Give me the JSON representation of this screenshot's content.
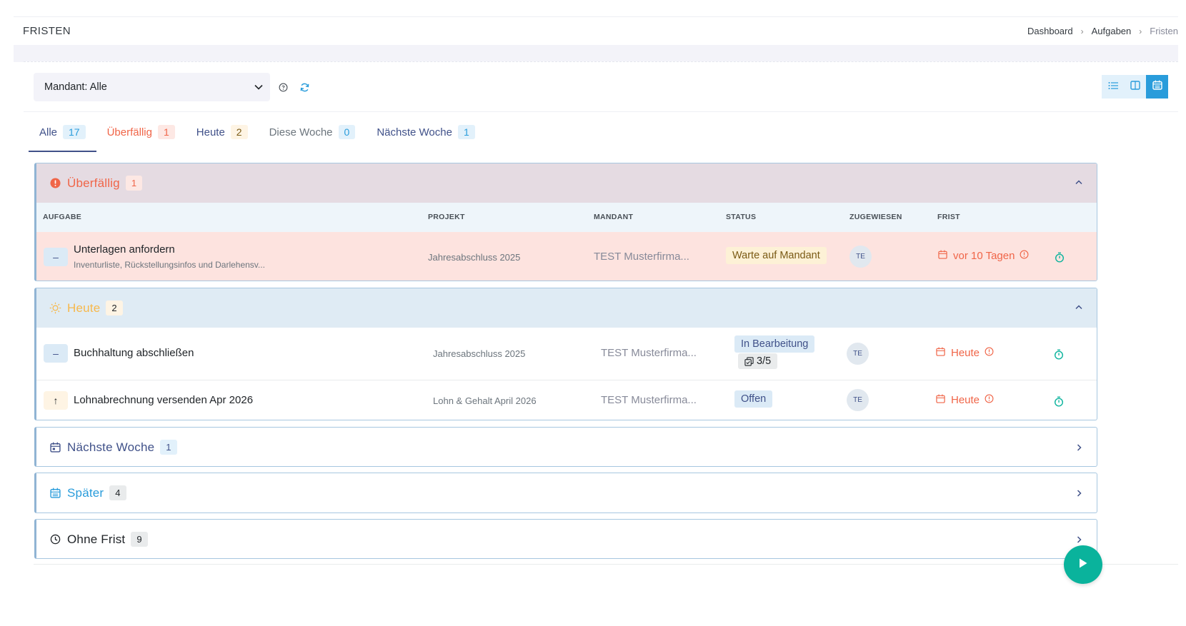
{
  "header": {
    "title": "FRISTEN",
    "breadcrumb": [
      "Dashboard",
      "Aufgaben",
      "Fristen"
    ]
  },
  "toolbar": {
    "mandant_select": "Mandant: Alle",
    "help_icon": "help-circle-icon",
    "refresh_icon": "refresh-icon",
    "views": [
      {
        "name": "list-view",
        "icon": "list-icon",
        "active": false
      },
      {
        "name": "kanban-view",
        "icon": "columns-icon",
        "active": false
      },
      {
        "name": "calendar-view",
        "icon": "calendar-icon",
        "active": true
      }
    ]
  },
  "tabs": [
    {
      "label": "Alle",
      "count": "17",
      "active": true
    },
    {
      "label": "Überfällig",
      "count": "1"
    },
    {
      "label": "Heute",
      "count": "2"
    },
    {
      "label": "Diese Woche",
      "count": "0"
    },
    {
      "label": "Nächste Woche",
      "count": "1"
    }
  ],
  "columns": [
    "AUFGABE",
    "PROJEKT",
    "MANDANT",
    "STATUS",
    "ZUGEWIESEN",
    "FRIST"
  ],
  "groups": {
    "overdue": {
      "title": "Überfällig",
      "count": "1",
      "expanded": true,
      "rows": [
        {
          "priority": "–",
          "title": "Unterlagen anfordern",
          "subtitle": "Inventurliste, Rückstellungsinfos und Darlehensv...",
          "project": "Jahresabschluss 2025",
          "client": "TEST Musterfirma...",
          "status": "Warte auf Mandant",
          "assignee": "TE",
          "due": "vor 10 Tagen"
        }
      ]
    },
    "today": {
      "title": "Heute",
      "count": "2",
      "expanded": true,
      "rows": [
        {
          "priority": "–",
          "title": "Buchhaltung abschließen",
          "project": "Jahresabschluss 2025",
          "client": "TEST Musterfirma...",
          "status": "In Bearbeitung",
          "subtasks": "3/5",
          "assignee": "TE",
          "due": "Heute"
        },
        {
          "priority": "↑",
          "title": "Lohnabrechnung versenden Apr 2026",
          "project": "Lohn & Gehalt April 2026",
          "client": "TEST Musterfirma...",
          "status": "Offen",
          "assignee": "TE",
          "due": "Heute"
        }
      ]
    },
    "next_week": {
      "title": "Nächste Woche",
      "count": "1",
      "expanded": false
    },
    "later": {
      "title": "Später",
      "count": "4",
      "expanded": false
    },
    "no_due": {
      "title": "Ohne Frist",
      "count": "9",
      "expanded": false
    }
  },
  "colors": {
    "primary": "#405189",
    "info": "#299cdb",
    "danger": "#f06548",
    "warning": "#f7b84b",
    "success": "#0ab39c"
  }
}
